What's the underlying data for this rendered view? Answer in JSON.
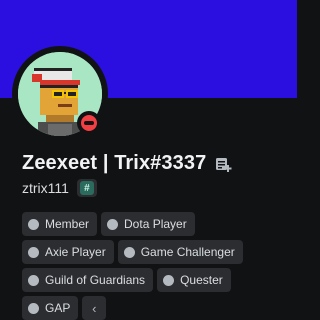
{
  "profile": {
    "display_name": "Zeexeet | Trix#3337",
    "username": "ztrix111",
    "status": "dnd",
    "tag_icon": "#"
  },
  "icons": {
    "edit": "note-edit-icon",
    "tag": "hashtag-badge-icon",
    "more": "chevron-left-icon"
  },
  "colors": {
    "banner": "#2a0fe0",
    "status_dnd": "#f23f43",
    "role_dot": "#b5bac1"
  },
  "roles": [
    "Member",
    "Dota Player",
    "Axie Player",
    "Game Challenger",
    "Guild of Guardians",
    "Quester",
    "GAP"
  ],
  "more_label": "‹"
}
